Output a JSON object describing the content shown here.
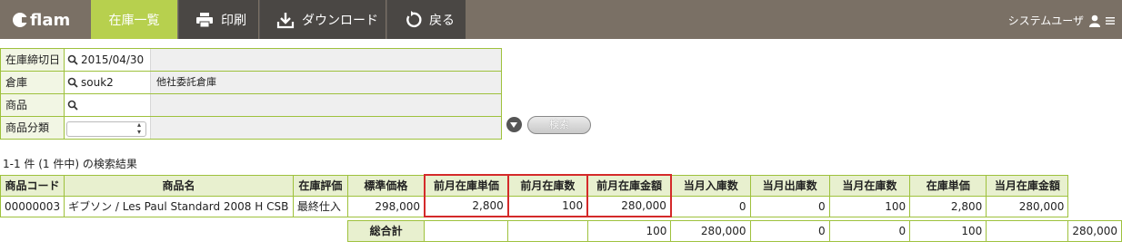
{
  "app": {
    "logo_text": "flam"
  },
  "nav": {
    "active_label": "在庫一覧",
    "print_label": "印刷",
    "download_label": "ダウンロード",
    "back_label": "戻る"
  },
  "user": {
    "name": "システムユーザ"
  },
  "form": {
    "cutoff": {
      "label": "在庫締切日",
      "value": "2015/04/30"
    },
    "warehouse": {
      "label": "倉庫",
      "code": "souk2",
      "name": "他社委託倉庫"
    },
    "product": {
      "label": "商品",
      "value": ""
    },
    "category": {
      "label": "商品分類",
      "selected": ""
    },
    "search_label": "検索"
  },
  "result_text": "1-1 件 (1 件中) の検索結果",
  "table": {
    "headers": [
      "商品コード",
      "商品名",
      "在庫評価",
      "標準価格",
      "前月在庫単価",
      "前月在庫数",
      "前月在庫金額",
      "当月入庫数",
      "当月出庫数",
      "当月在庫数",
      "在庫単価",
      "当月在庫金額"
    ],
    "rows": [
      [
        "00000003",
        "ギブソン / Les Paul Standard 2008 H CSB",
        "最終仕入",
        "298,000",
        "2,800",
        "100",
        "280,000",
        "0",
        "0",
        "100",
        "2,800",
        "280,000"
      ]
    ],
    "total": {
      "label": "総合計",
      "cells": [
        "",
        "",
        "100",
        "280,000",
        "0",
        "0",
        "100",
        "",
        "280,000"
      ]
    }
  },
  "colors": {
    "accent": "#b7d04e",
    "border": "#9ec13c",
    "highlight": "#d42a2a"
  }
}
